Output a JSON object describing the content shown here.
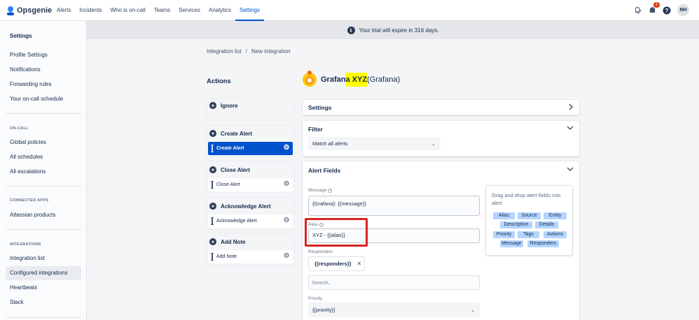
{
  "app": {
    "name": "Opsgenie"
  },
  "nav": {
    "items": [
      "Alerts",
      "Incidents",
      "Who is on-call",
      "Teams",
      "Services",
      "Analytics",
      "Settings"
    ],
    "active": "Settings",
    "notification_count": "3",
    "avatar_initials": "NH"
  },
  "sidebar": {
    "title": "Settings",
    "items": [
      "Profile Settings",
      "Notifications",
      "Forwarding rules",
      "Your on-call schedule"
    ],
    "oncall_heading": "ON-CALL",
    "oncall_items": [
      "Global policies",
      "All schedules",
      "All escalations"
    ],
    "apps_heading": "CONNECTED APPS",
    "apps_items": [
      "Atlassian products"
    ],
    "integrations_heading": "INTEGRATIONS",
    "integrations_items": [
      "Integration list",
      "Configured integrations",
      "Heartbeats",
      "Slack"
    ],
    "active_item": "Configured integrations"
  },
  "banner": {
    "text": "Your trial will expire in 316 days.",
    "icon": "info-icon"
  },
  "breadcrumb": {
    "items": [
      "Integration list",
      "New integration"
    ],
    "separator": "/"
  },
  "actions": {
    "title": "Actions",
    "groups": [
      {
        "title": "Ignore",
        "rows": []
      },
      {
        "title": "Create Alert",
        "rows": [
          "Create Alert"
        ],
        "selected": true
      },
      {
        "title": "Close Alert",
        "rows": [
          "Close Alert"
        ]
      },
      {
        "title": "Acknowledge Alert",
        "rows": [
          "Acknowledge Alert"
        ]
      },
      {
        "title": "Add Note",
        "rows": [
          "Add Note"
        ]
      }
    ]
  },
  "integration": {
    "name_part1": "Grafan",
    "name_highlight": "a XYZ",
    "name_part2": " (Grafana)",
    "logo": "grafana-logo"
  },
  "settings_panel": {
    "title": "Settings"
  },
  "filter_panel": {
    "title": "Filter",
    "value": "Match all alerts"
  },
  "alert_fields": {
    "title": "Alert Fields",
    "message_label": "Message",
    "message_value": "{Grafana}: {{message}}",
    "alias_label": "Alias",
    "alias_value": "XYZ - {{alias}}",
    "responders_label": "Responders",
    "responders_chip": "{{responders}}",
    "search_placeholder": "Search..",
    "priority_label": "Priority",
    "priority_value": "{{priority}}",
    "drag_hint": "Drag and drop alert fields into alert",
    "tags": [
      "Alias",
      "Source",
      "Entity",
      "Description",
      "Details",
      "Priority",
      "Tags",
      "Actions",
      "Message",
      "Responders"
    ]
  },
  "colors": {
    "accent": "#0052cc",
    "highlight": "#ffff00",
    "annotation_box": "#d62424",
    "tag_bg": "#b3d4ff"
  }
}
